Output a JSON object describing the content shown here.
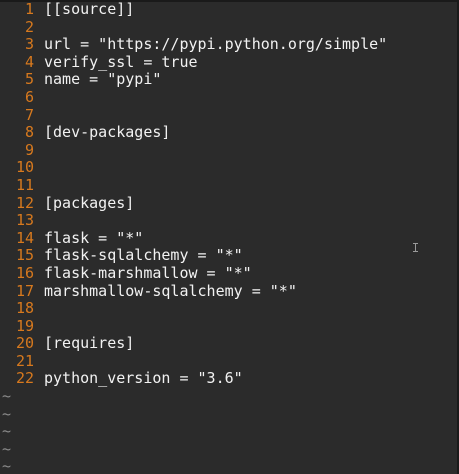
{
  "editor": {
    "lines": [
      {
        "num": "1",
        "text": "[[source]]"
      },
      {
        "num": "2",
        "text": ""
      },
      {
        "num": "3",
        "text": "url = \"https://pypi.python.org/simple\""
      },
      {
        "num": "4",
        "text": "verify_ssl = true"
      },
      {
        "num": "5",
        "text": "name = \"pypi\""
      },
      {
        "num": "6",
        "text": ""
      },
      {
        "num": "7",
        "text": ""
      },
      {
        "num": "8",
        "text": "[dev-packages]"
      },
      {
        "num": "9",
        "text": ""
      },
      {
        "num": "10",
        "text": ""
      },
      {
        "num": "11",
        "text": ""
      },
      {
        "num": "12",
        "text": "[packages]"
      },
      {
        "num": "13",
        "text": ""
      },
      {
        "num": "14",
        "text": "flask = \"*\""
      },
      {
        "num": "15",
        "text": "flask-sqlalchemy = \"*\""
      },
      {
        "num": "16",
        "text": "flask-marshmallow = \"*\""
      },
      {
        "num": "17",
        "text": "marshmallow-sqlalchemy = \"*\""
      },
      {
        "num": "18",
        "text": ""
      },
      {
        "num": "19",
        "text": ""
      },
      {
        "num": "20",
        "text": "[requires]"
      },
      {
        "num": "21",
        "text": ""
      },
      {
        "num": "22",
        "text": "python_version = \"3.6\""
      }
    ],
    "tildes": [
      "~",
      "~",
      "~",
      "~",
      "~"
    ]
  },
  "colors": {
    "background": "#2b2b2b",
    "line_number": "#d7791e",
    "text": "#f2f2f2",
    "tilde": "#8a8a8a"
  }
}
